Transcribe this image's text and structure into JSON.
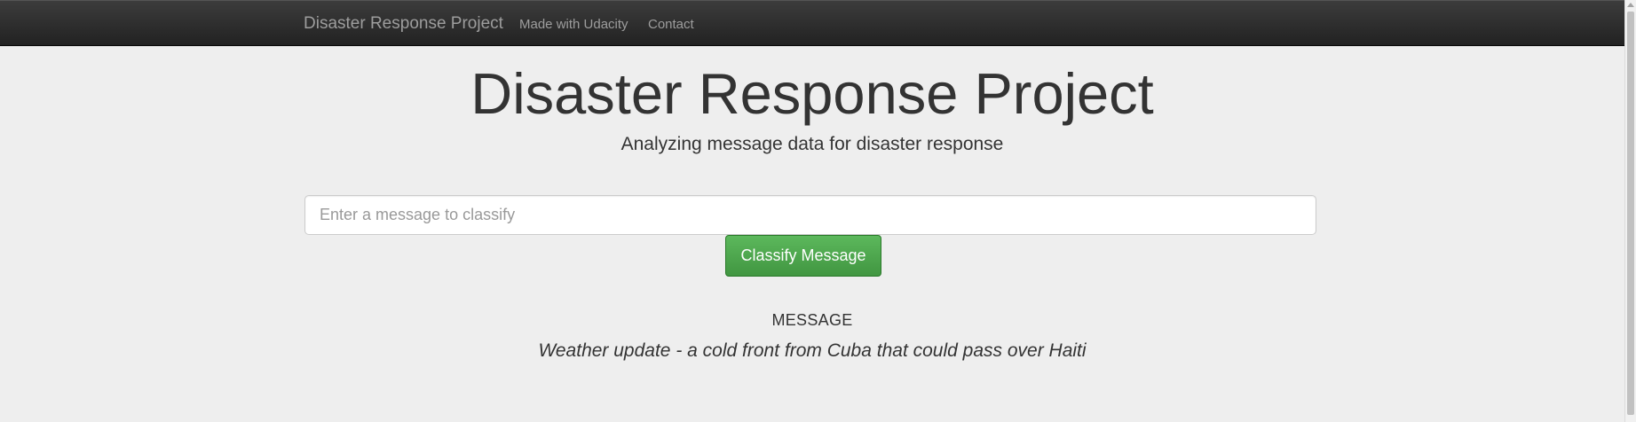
{
  "navbar": {
    "brand": "Disaster Response Project",
    "links": [
      {
        "label": "Made with Udacity"
      },
      {
        "label": "Contact"
      }
    ]
  },
  "header": {
    "title": "Disaster Response Project",
    "subtitle": "Analyzing message data for disaster response"
  },
  "form": {
    "placeholder": "Enter a message to classify",
    "value": "",
    "submit_label": "Classify Message"
  },
  "result": {
    "heading": "MESSAGE",
    "message": "Weather update - a cold front from Cuba that could pass over Haiti"
  },
  "colors": {
    "navbar_bg": "#222222",
    "page_bg": "#eeeeee",
    "button_green": "#5cb85c",
    "text": "#333333"
  }
}
